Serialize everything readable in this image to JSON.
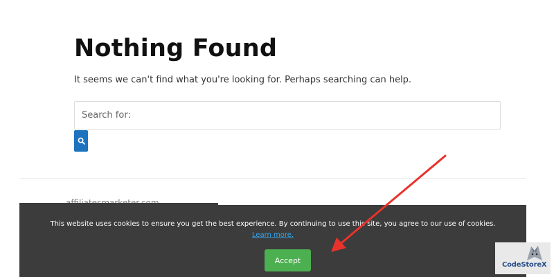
{
  "page": {
    "title": "Nothing Found",
    "message": "It seems we can't find what you're looking for. Perhaps searching can help."
  },
  "search": {
    "placeholder": "Search for:",
    "value": "",
    "button_icon": "search-icon",
    "button_color": "#1e73be"
  },
  "footer": {
    "site_name": "affiliatesmarketer.com"
  },
  "cookie_banner": {
    "message": "This website uses cookies to ensure you get the best experience. By continuing to use this site, you agree to our use of cookies.",
    "learn_more": "Learn more.",
    "accept_label": "Accept",
    "background_color": "#3c3c3c",
    "accept_color": "#4caf50",
    "link_color": "#31a8f0"
  },
  "annotation": {
    "arrow_color": "#e8322b",
    "target": "cookie-banner"
  },
  "watermark": {
    "brand": "CodeStoreX"
  }
}
